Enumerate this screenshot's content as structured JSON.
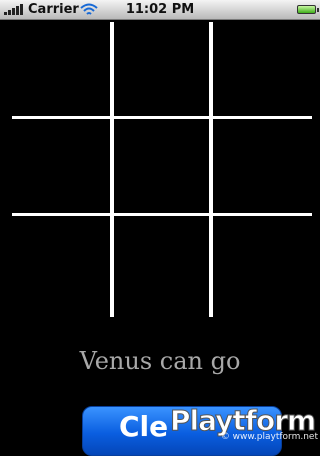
{
  "status_bar": {
    "carrier": "Carrier",
    "time": "11:02 PM",
    "icons": [
      "signal-bars-icon",
      "wifi-icon",
      "battery-icon"
    ]
  },
  "board": {
    "rows": 3,
    "cols": 3,
    "line_color": "#ffffff",
    "cells": [
      "",
      "",
      "",
      "",
      "",
      "",
      "",
      "",
      ""
    ]
  },
  "game": {
    "status_text": "Venus can go"
  },
  "clear_button": {
    "label": "Cle",
    "color": "#0a5ee0"
  },
  "watermark": {
    "logo": "Playtform",
    "url": "© www.playtform.net"
  }
}
